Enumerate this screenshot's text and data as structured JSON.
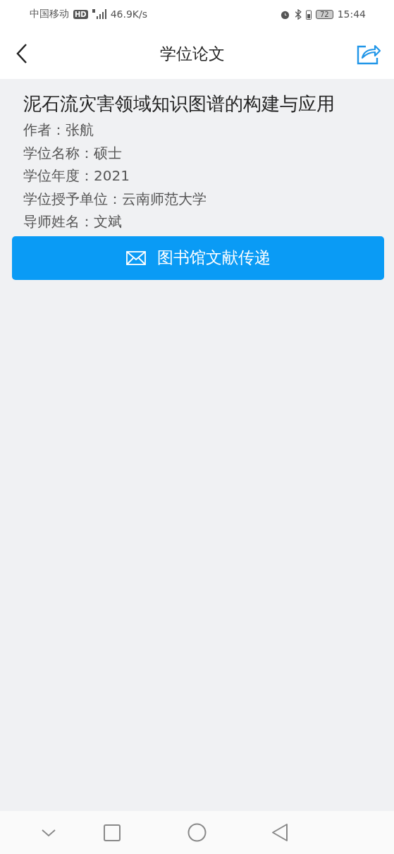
{
  "status_bar": {
    "carrier": "中国移动",
    "hd_badge": "HD",
    "network_speed": "46.9K/s",
    "battery": "72",
    "time": "15:44"
  },
  "header": {
    "title": "学位论文"
  },
  "thesis": {
    "title": "泥石流灾害领域知识图谱的构建与应用",
    "details": [
      "作者：张航",
      "学位名称：硕士",
      "学位年度：2021",
      "学位授予单位：云南师范大学",
      "导师姓名：文斌"
    ]
  },
  "action_button": {
    "label": "图书馆文献传递"
  }
}
